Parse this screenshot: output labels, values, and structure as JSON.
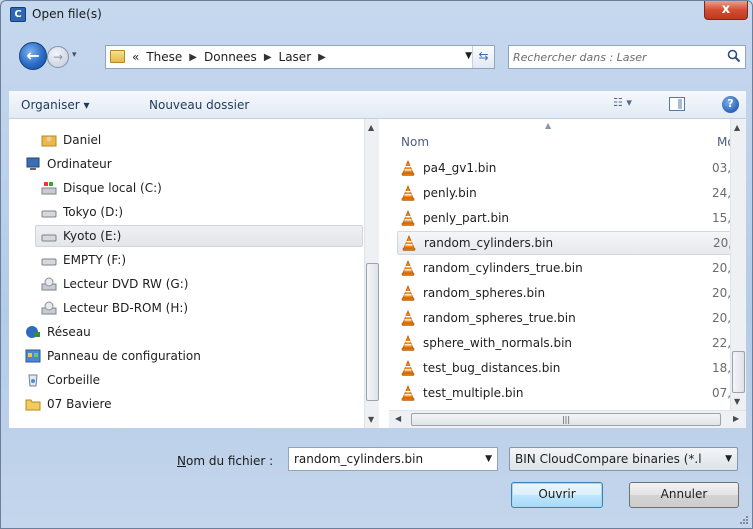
{
  "window": {
    "title": "Open file(s)",
    "close": "x",
    "app_icon": "C"
  },
  "nav": {
    "back": "back-arrow-icon",
    "breadcrumbs": [
      "«",
      "These",
      "Donnees",
      "Laser"
    ],
    "search_placeholder": "Rechercher dans : Laser"
  },
  "toolbar": {
    "organize": "Organiser ▾",
    "new_folder": "Nouveau dossier",
    "help": "?"
  },
  "sidebar": {
    "items": [
      {
        "label": "Daniel",
        "icon": "user-folder-icon"
      },
      {
        "label": "Ordinateur",
        "icon": "computer-icon"
      },
      {
        "label": "Disque local (C:)",
        "icon": "windows-drive-icon"
      },
      {
        "label": "Tokyo (D:)",
        "icon": "drive-icon"
      },
      {
        "label": "Kyoto (E:)",
        "icon": "drive-icon",
        "selected": true
      },
      {
        "label": "EMPTY (F:)",
        "icon": "drive-icon"
      },
      {
        "label": "Lecteur DVD RW (G:)",
        "icon": "dvd-drive-icon"
      },
      {
        "label": "Lecteur BD-ROM (H:)",
        "icon": "dvd-drive-icon"
      },
      {
        "label": "Réseau",
        "icon": "network-icon"
      },
      {
        "label": "Panneau de configuration",
        "icon": "control-panel-icon"
      },
      {
        "label": "Corbeille",
        "icon": "recycle-bin-icon"
      },
      {
        "label": "07 Baviere",
        "icon": "folder-icon"
      }
    ]
  },
  "files": {
    "columns": {
      "name": "Nom",
      "modified": "Mo"
    },
    "rows": [
      {
        "name": "pa4_gv1.bin",
        "date": "03,"
      },
      {
        "name": "penly.bin",
        "date": "24,"
      },
      {
        "name": "penly_part.bin",
        "date": "15,"
      },
      {
        "name": "random_cylinders.bin",
        "date": "20,",
        "selected": true
      },
      {
        "name": "random_cylinders_true.bin",
        "date": "20,"
      },
      {
        "name": "random_spheres.bin",
        "date": "20,"
      },
      {
        "name": "random_spheres_true.bin",
        "date": "20,"
      },
      {
        "name": "sphere_with_normals.bin",
        "date": "22,"
      },
      {
        "name": "test_bug_distances.bin",
        "date": "18,"
      },
      {
        "name": "test_multiple.bin",
        "date": "07,"
      }
    ]
  },
  "bottom": {
    "filename_label_u": "N",
    "filename_label_rest": "om du fichier :",
    "filename_value": "random_cylinders.bin",
    "filter": "BIN CloudCompare binaries (*.l",
    "open": "Ouvrir",
    "cancel": "Annuler"
  },
  "colors": {
    "accent": "#2a6cc6",
    "selection": "#e6e9ed",
    "close": "#c0371d"
  }
}
